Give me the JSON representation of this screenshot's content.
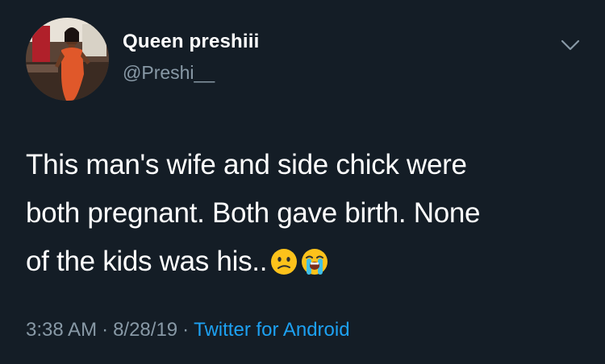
{
  "tweet": {
    "display_name": "Queen preshiii",
    "handle": "@Preshi__",
    "text_lines": [
      "This man's wife and side chick were",
      "both pregnant. Both gave birth. None",
      "of the kids was his.."
    ],
    "emojis": [
      "confused-face-emoji",
      "loudly-crying-face-emoji"
    ],
    "time": "3:38 AM",
    "date": "8/28/19",
    "separator": "·",
    "source": "Twitter for Android"
  },
  "colors": {
    "background": "#141d26",
    "text": "#ffffff",
    "secondary_text": "#8899a6",
    "link": "#1da1f2"
  },
  "icons": {
    "more_menu": "chevron-down-icon"
  }
}
